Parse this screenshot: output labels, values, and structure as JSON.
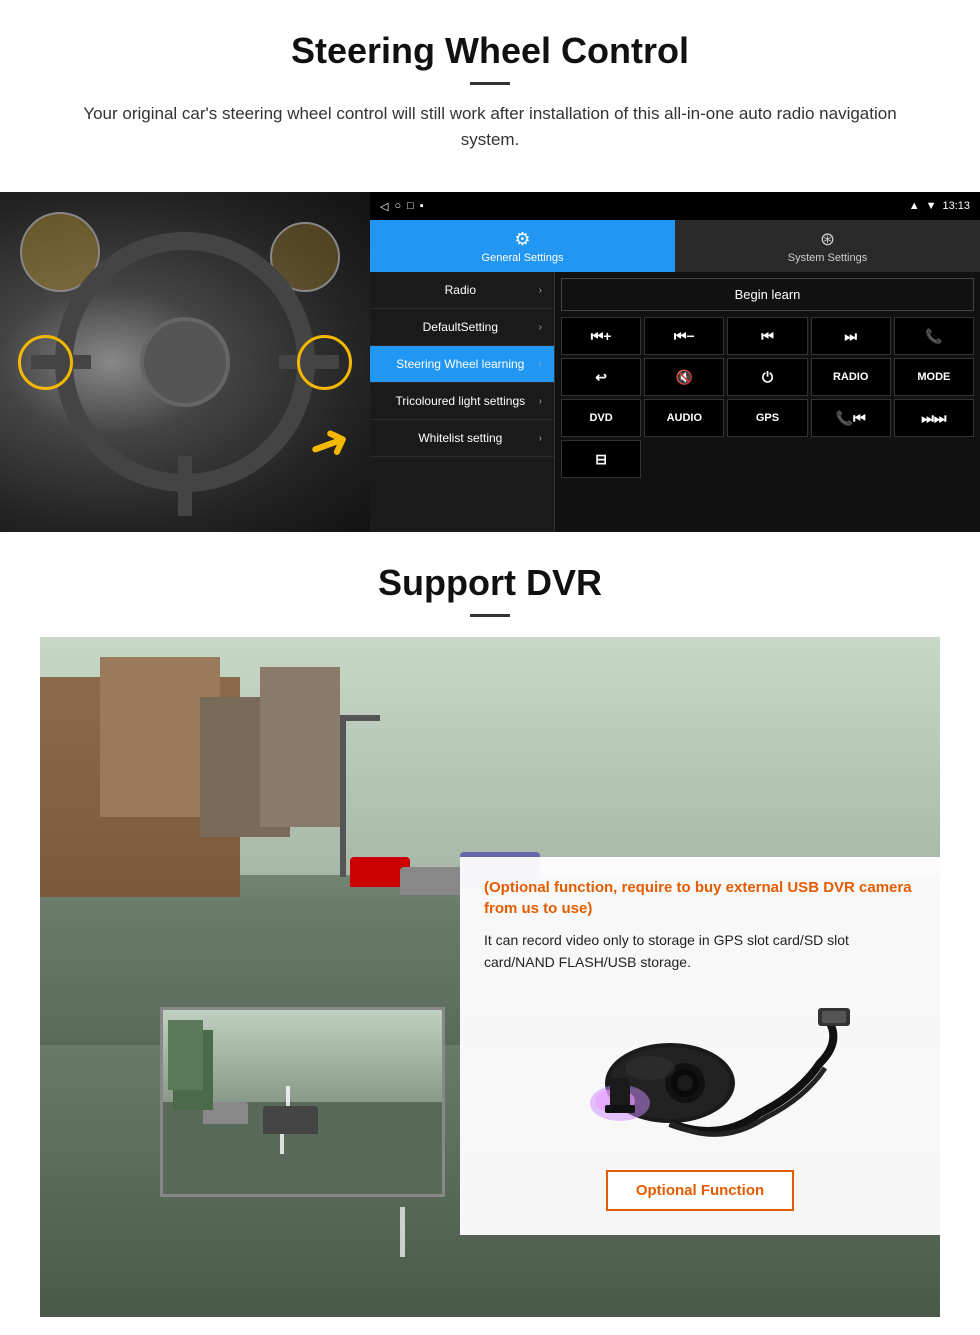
{
  "section1": {
    "title": "Steering Wheel Control",
    "subtitle": "Your original car's steering wheel control will still work after installation of this all-in-one auto radio navigation system.",
    "statusbar": {
      "nav_icons": "◁  ○  □  ▪",
      "time": "13:13",
      "signal": "▼"
    },
    "tabs": {
      "general": {
        "icon": "⚙",
        "label": "General Settings"
      },
      "system": {
        "icon": "⊕",
        "label": "System Settings"
      }
    },
    "menu_items": [
      {
        "label": "Radio",
        "active": false
      },
      {
        "label": "DefaultSetting",
        "active": false
      },
      {
        "label": "Steering Wheel learning",
        "active": true
      },
      {
        "label": "Tricoloured light settings",
        "active": false
      },
      {
        "label": "Whitelist setting",
        "active": false
      }
    ],
    "begin_learn": "Begin learn",
    "ctrl_buttons": [
      "⏮+",
      "⏮-",
      "⏮⏮",
      "⏭⏭",
      "📞",
      "↩",
      "🔇",
      "⏻",
      "RADIO",
      "MODE",
      "DVD",
      "AUDIO",
      "GPS",
      "📞⏮",
      "⏭⏭"
    ],
    "bottom_btn": "⊟"
  },
  "section2": {
    "title": "Support DVR",
    "optional_text": "(Optional function, require to buy external USB DVR camera from us to use)",
    "desc_text": "It can record video only to storage in GPS slot card/SD slot card/NAND FLASH/USB storage.",
    "optional_btn_label": "Optional Function"
  }
}
